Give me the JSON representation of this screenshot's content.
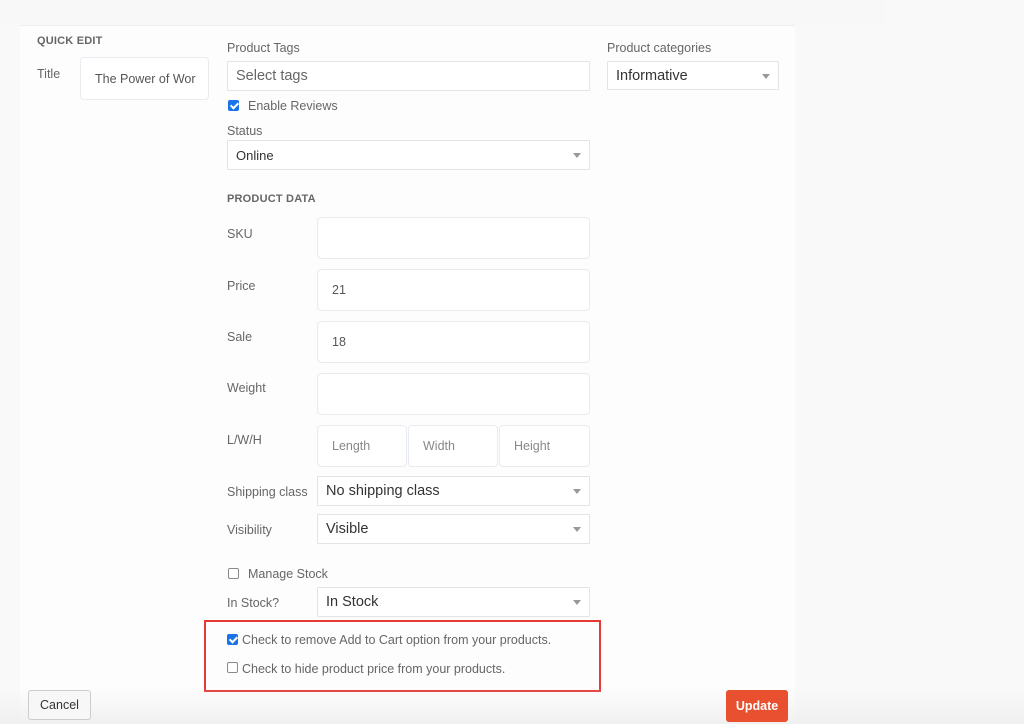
{
  "quick_edit": {
    "heading": "QUICK EDIT",
    "title_label": "Title",
    "title_value": "The Power of Wor"
  },
  "tags": {
    "label": "Product Tags",
    "placeholder": "Select tags"
  },
  "reviews": {
    "label": "Enable Reviews",
    "checked": true
  },
  "status": {
    "label": "Status",
    "value": "Online"
  },
  "categories": {
    "label": "Product categories",
    "value": "Informative"
  },
  "product_data": {
    "heading": "PRODUCT DATA",
    "sku": {
      "label": "SKU",
      "value": ""
    },
    "price": {
      "label": "Price",
      "value": "21"
    },
    "sale": {
      "label": "Sale",
      "value": "18"
    },
    "weight": {
      "label": "Weight",
      "value": ""
    },
    "dimensions": {
      "label": "L/W/H",
      "length_placeholder": "Length",
      "width_placeholder": "Width",
      "height_placeholder": "Height"
    },
    "shipping_class": {
      "label": "Shipping class",
      "value": "No shipping class"
    },
    "visibility": {
      "label": "Visibility",
      "value": "Visible"
    },
    "manage_stock": {
      "label": "Manage Stock",
      "checked": false
    },
    "in_stock": {
      "label": "In Stock?",
      "value": "In Stock"
    }
  },
  "extra_options": {
    "remove_cart": {
      "label": "Check to remove Add to Cart option from your products.",
      "checked": true
    },
    "hide_price": {
      "label": "Check to hide product price from your products.",
      "checked": false
    },
    "highlight_color": "#e53935"
  },
  "actions": {
    "cancel_label": "Cancel",
    "update_label": "Update",
    "update_color": "#e8502f"
  }
}
